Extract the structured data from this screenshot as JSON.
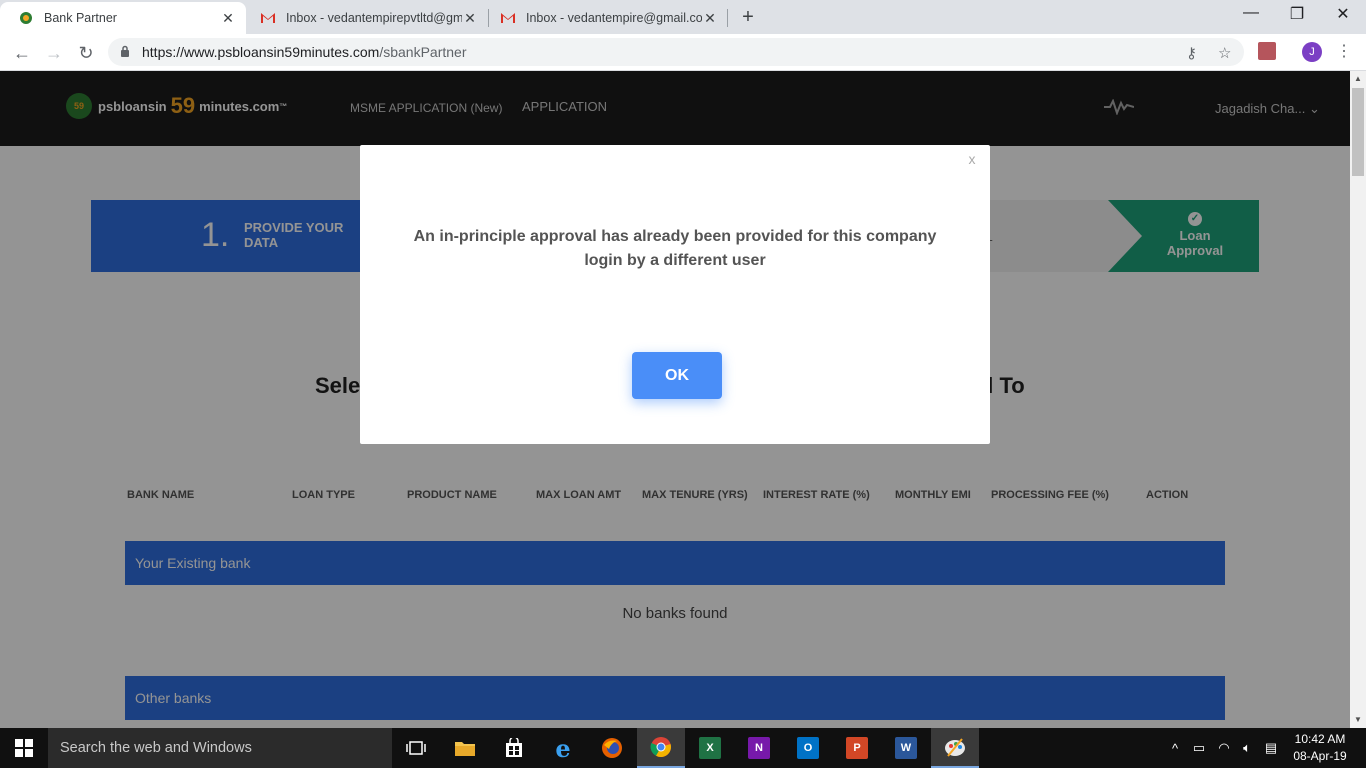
{
  "browser": {
    "tabs": [
      {
        "title": "Bank Partner",
        "active": true
      },
      {
        "title": "Inbox - vedantempirepvtltd@gm",
        "active": false
      },
      {
        "title": "Inbox - vedantempire@gmail.co",
        "active": false
      }
    ],
    "url_host": "https://www.psbloansin59minutes.com",
    "url_path": "/sbankPartner",
    "profile_initial": "J"
  },
  "site": {
    "logo_prefix": "psbloansin",
    "logo_number": "59",
    "logo_suffix": "minutes.com",
    "logo_tm": "™",
    "nav": {
      "msme": "MSME APPLICATION (New)",
      "application": "APPLICATION"
    },
    "user_name": "Jagadish Cha...",
    "steps": {
      "step1_num": "1.",
      "step1_label": "PROVIDE YOUR DATA",
      "loan_label": "Loan Approval"
    },
    "heading_left": "Sele",
    "heading_right": "al To",
    "table_headers": [
      "BANK NAME",
      "LOAN TYPE",
      "PRODUCT NAME",
      "MAX LOAN AMT",
      "MAX TENURE (YRS)",
      "INTEREST RATE (%)",
      "MONTHLY EMI",
      "PROCESSING FEE (%)",
      "ACTION"
    ],
    "existing_bank_label": "Your Existing bank",
    "no_banks": "No banks found",
    "other_banks_label": "Other banks"
  },
  "modal": {
    "close_label": "x",
    "message": "An in-principle approval has already been provided for this company login by a different user",
    "ok_label": "OK"
  },
  "taskbar": {
    "search_placeholder": "Search the web and Windows",
    "time": "10:42 AM",
    "date": "08-Apr-19"
  },
  "colors": {
    "primary_blue": "#2f6fe0",
    "success_green": "#1ea37a",
    "ok_button": "#4a8ef8"
  }
}
